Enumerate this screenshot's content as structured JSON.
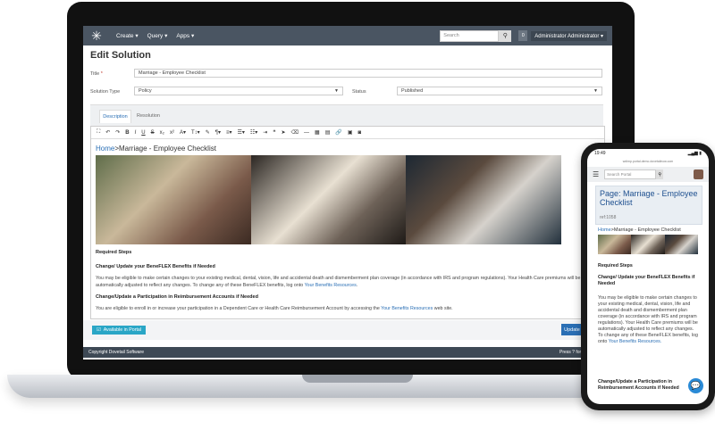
{
  "navbar": {
    "menu": [
      "Create ▾",
      "Query ▾",
      "Apps ▾"
    ],
    "search_placeholder": "Search",
    "badge": "0",
    "user": "Administrator Administrator ▾"
  },
  "page": {
    "title": "Edit Solution"
  },
  "form": {
    "title_label": "Title",
    "title_value": "Marriage - Employee Checklist",
    "solution_type_label": "Solution Type",
    "solution_type_value": "Policy",
    "status_label": "Status",
    "status_value": "Published"
  },
  "tabs": [
    "Description",
    "Resolution"
  ],
  "editor": {
    "breadcrumb_home": "Home",
    "breadcrumb_rest": ">Marriage - Employee Checklist",
    "required_steps": "Required Steps",
    "heading1": "Change/ Update your BeneFLEX Benefits if Needed",
    "para1a": "You may be eligible to make certain changes to your existing medical, dental, vision, life and accidental death and dismemberment plan coverage (in accordance with IRS and program regulations). Your Health Care premiums will be automatically adjusted to reflect any changes. To change any of these BeneFLEX benefits, log onto ",
    "para1_link": "Your Benefits Resources",
    "para1b": ".",
    "heading2": "Change/Update a Participation in Reimbursement Accounts if Needed",
    "para2a": "You are eligible to enroll in or increase your participation in a Dependent Care or Health Care Reimbursement Account by accessing the ",
    "para2_link": "Your Benefits Resources",
    "para2b": " web site."
  },
  "footer": {
    "available_in_portal": "Available in Portal",
    "update_button": "Update",
    "copyright": "Copyright Dovetail Software",
    "press_hint": "Press ? for avail"
  },
  "phone": {
    "time": "19:49",
    "url": "wdimp.portal.demo.dovetailnow.com",
    "search_placeholder": "Search Portal",
    "card_title": "Page: Marriage - Employee Checklist",
    "ref": "ref:1058",
    "breadcrumb_home": "Home",
    "breadcrumb_rest": ">Marriage - Employee Checklist",
    "required_steps": "Required Steps",
    "heading1": "Change/ Update your BeneFLEX Benefits if Needed",
    "para1": "You may be eligible to make certain changes to your existing medical, dental, vision, life and accidental death and dismemberment plan coverage (in accordance with IRS and program regulations). Your Health Care premiums will be automatically adjusted to reflect any changes. To change any of these BeneFLEX benefits, log onto ",
    "para1_link": "Your Benefits Resources.",
    "heading2": "Change/Update a Participation in Reimbursement Accounts if Needed"
  },
  "colors": {
    "navbar": "#4a5562",
    "accent": "#2a6fb5",
    "portal_toggle": "#2aa6c6"
  }
}
